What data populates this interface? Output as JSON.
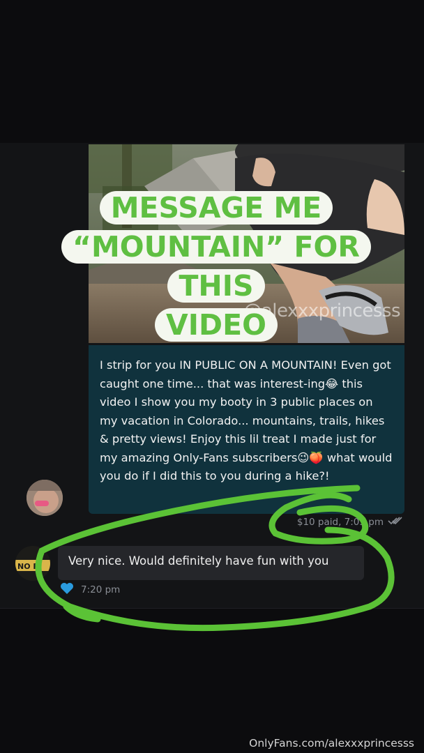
{
  "promo": {
    "line1": "MESSAGE ME",
    "line2": "“MOUNTAIN” FOR THIS",
    "line3": "VIDEO",
    "color": "#5fbf42"
  },
  "media": {
    "watermark": "@alexxxprincesss"
  },
  "sent_message": {
    "text": "I strip for you IN PUBLIC ON A MOUNTAIN! Even got caught one time... that was interest-ing😂 this video I show you my booty in 3 public places on my vacation in Colorado... mountains, trails, hikes & pretty views! Enjoy this lil treat I made just for my amazing Only-Fans subscribers😉🍑 what would you do if I did this to you during a hike?!",
    "price_status": "$10 paid, 7:05 pm",
    "read_icon": "double-check-icon",
    "bubble_color": "#10323d"
  },
  "received_message": {
    "text": "Very nice. Would definitely have fun with you",
    "time": "7:20 pm",
    "like_icon": "heart-icon",
    "like_color": "#2a9bde"
  },
  "sender_avatar_badge": "NO F",
  "footer": {
    "watermark": "OnlyFans.com/alexxxprincesss"
  }
}
